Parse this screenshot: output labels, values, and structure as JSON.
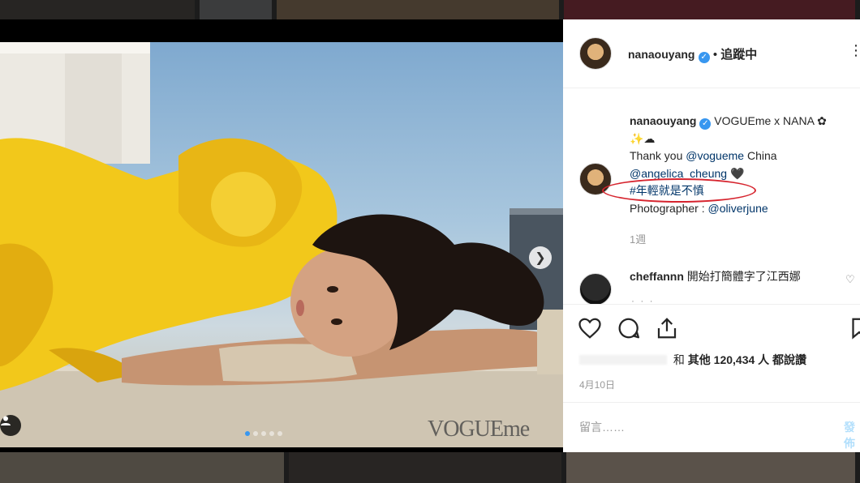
{
  "post": {
    "username": "nanaouyang",
    "follow_status": "追蹤中",
    "separator": "•",
    "more_icon": "more-icon"
  },
  "caption": {
    "username": "nanaouyang",
    "line1": "VOGUEme x NANA",
    "flower_glyph": "✿",
    "emoji_line": "✨☁",
    "thank_prefix": "Thank you ",
    "mention1": "@vogueme",
    "thank_suffix": " China",
    "mention2": "@angelica_cheung",
    "heart_glyph": "🖤",
    "hashtag": "#年輕就是不慎",
    "photographer_prefix": "Photographer : ",
    "mention3": "@oliverjune",
    "time_ago": "1週"
  },
  "comment": {
    "username": "cheffannn",
    "text": "開始打簡體字了江西娜"
  },
  "likes": {
    "and_text": "和",
    "others_text": "其他",
    "count": "120,434",
    "suffix": "人 都說讚"
  },
  "date": "4月10日",
  "add_comment_placeholder": "留言……",
  "post_button": "發佈",
  "photo": {
    "watermark": "VOGUEme",
    "carousel_total": 5,
    "carousel_active": 0
  },
  "colors": {
    "verified": "#3897f0",
    "highlight_ring": "#d6242e",
    "link": "#003569",
    "dress": "#f2c81b"
  }
}
